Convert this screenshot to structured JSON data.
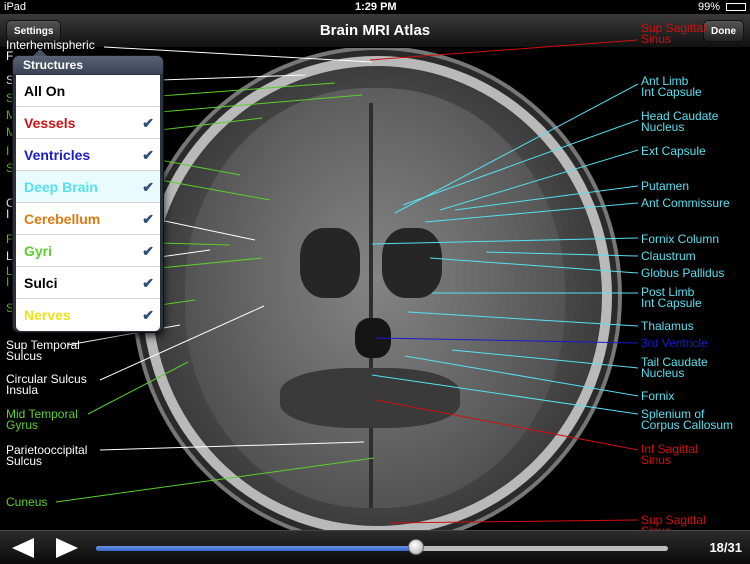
{
  "status_bar": {
    "device": "iPad",
    "time": "1:29 PM",
    "battery": "99%"
  },
  "nav": {
    "title": "Brain MRI Atlas",
    "settings_label": "Settings",
    "done_label": "Done"
  },
  "popover": {
    "title": "Structures",
    "items": [
      {
        "label": "All On",
        "color": "#000000",
        "checked": false
      },
      {
        "label": "Vessels",
        "color": "#d01010",
        "checked": true
      },
      {
        "label": "Ventricles",
        "color": "#1a1ad0",
        "checked": true
      },
      {
        "label": "Deep Brain",
        "color": "#56e0f0",
        "checked": true
      },
      {
        "label": "Cerebellum",
        "color": "#e07a10",
        "checked": true
      },
      {
        "label": "Gyri",
        "color": "#5ad02a",
        "checked": true
      },
      {
        "label": "Sulci",
        "color": "#000000",
        "checked": true
      },
      {
        "label": "Nerves",
        "color": "#f0e020",
        "checked": true
      }
    ]
  },
  "left_labels": [
    {
      "l1": "Interhemispheric",
      "l2": "F",
      "color": "#ffffff"
    },
    {
      "l1": "S",
      "l2": "",
      "color": "#ffffff"
    },
    {
      "l1": "S",
      "l2": "",
      "color": "#5ad02a"
    },
    {
      "l1": "M",
      "l2": "",
      "color": "#5ad02a"
    },
    {
      "l1": "M",
      "l2": "",
      "color": "#5ad02a"
    },
    {
      "l1": "I",
      "l2": "",
      "color": "#5ad02a"
    },
    {
      "l1": "S",
      "l2": "",
      "color": "#5ad02a"
    },
    {
      "l1": "C",
      "l2": "I",
      "color": "#ffffff"
    },
    {
      "l1": "F",
      "l2": "",
      "color": "#5ad02a"
    },
    {
      "l1": "L",
      "l2": "",
      "color": "#ffffff"
    },
    {
      "l1": "L",
      "l2": "I",
      "color": "#5ad02a"
    },
    {
      "l1": "S",
      "l2": "",
      "color": "#5ad02a"
    },
    {
      "l1": "Sup Temporal",
      "l2": "Sulcus",
      "color": "#ffffff"
    },
    {
      "l1": "Circular Sulcus",
      "l2": "Insula",
      "color": "#ffffff"
    },
    {
      "l1": "Mid Temporal",
      "l2": "Gyrus",
      "color": "#5ad02a"
    },
    {
      "l1": "Parietooccipital",
      "l2": "Sulcus",
      "color": "#ffffff"
    },
    {
      "l1": "Cuneus",
      "l2": "",
      "color": "#5ad02a"
    }
  ],
  "right_labels": [
    {
      "l1": "Sup Sagittal",
      "l2": "Sinus",
      "color": "#d01010"
    },
    {
      "l1": "Ant Limb",
      "l2": "Int Capsule",
      "color": "#56e0f0"
    },
    {
      "l1": "Head Caudate",
      "l2": "Nucleus",
      "color": "#56e0f0"
    },
    {
      "l1": "Ext Capsule",
      "l2": "",
      "color": "#56e0f0"
    },
    {
      "l1": "Putamen",
      "l2": "",
      "color": "#56e0f0"
    },
    {
      "l1": "Ant Commissure",
      "l2": "",
      "color": "#56e0f0"
    },
    {
      "l1": "Fornix Column",
      "l2": "",
      "color": "#56e0f0"
    },
    {
      "l1": "Claustrum",
      "l2": "",
      "color": "#56e0f0"
    },
    {
      "l1": "Globus Pallidus",
      "l2": "",
      "color": "#56e0f0"
    },
    {
      "l1": "Post Limb",
      "l2": "Int Capsule",
      "color": "#56e0f0"
    },
    {
      "l1": "Thalamus",
      "l2": "",
      "color": "#56e0f0"
    },
    {
      "l1": "3rd Ventricle",
      "l2": "",
      "color": "#1a1ad0"
    },
    {
      "l1": "Tail Caudate",
      "l2": "Nucleus",
      "color": "#56e0f0"
    },
    {
      "l1": "Fornix",
      "l2": "",
      "color": "#56e0f0"
    },
    {
      "l1": "Splenium of",
      "l2": "Corpus Callosum",
      "color": "#56e0f0"
    },
    {
      "l1": "Inf Sagittal",
      "l2": "Sinus",
      "color": "#d01010"
    },
    {
      "l1": "Sup Sagittal",
      "l2": "Sinus",
      "color": "#d01010"
    }
  ],
  "bottom": {
    "page_text": "18/31",
    "progress": 0.56,
    "accent": "#3366cc"
  }
}
